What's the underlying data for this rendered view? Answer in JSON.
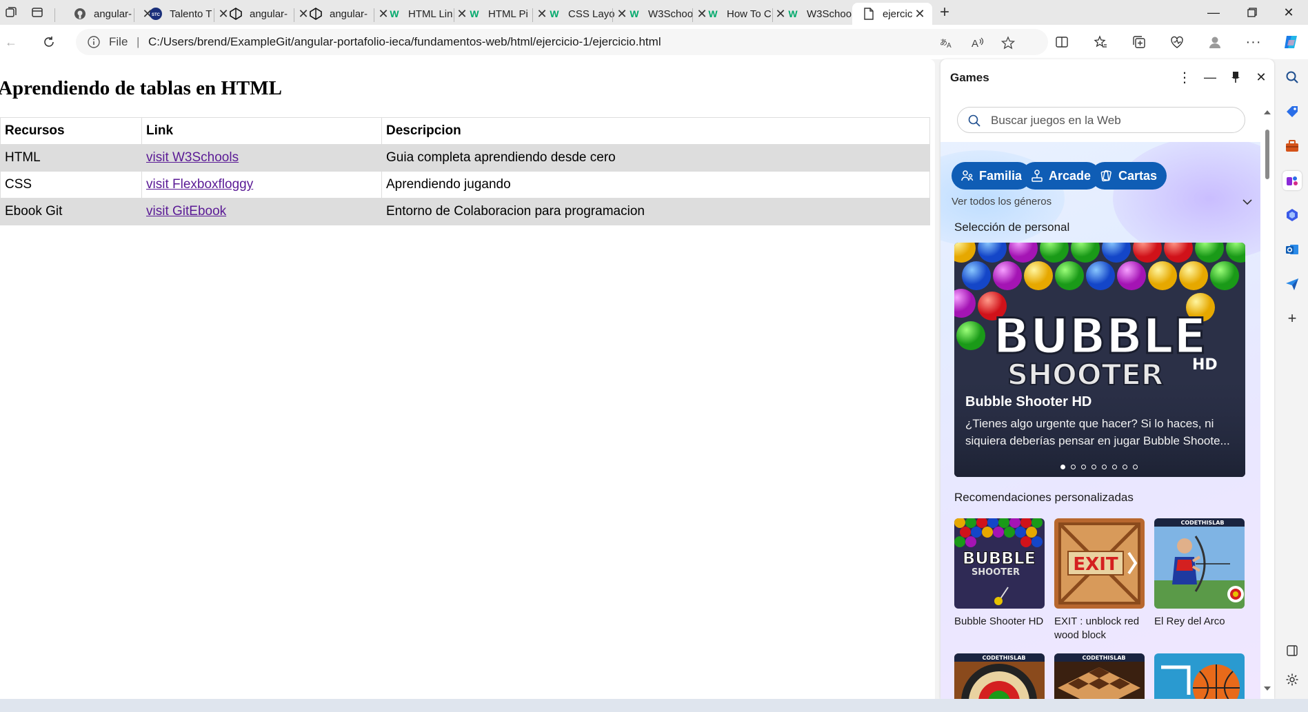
{
  "tabs": [
    {
      "title": "angular-",
      "icon": "github-icon"
    },
    {
      "title": "Talento T",
      "icon": "stc-icon"
    },
    {
      "title": "angular-",
      "icon": "codepen-icon"
    },
    {
      "title": "angular-",
      "icon": "codepen-icon"
    },
    {
      "title": "HTML Lin",
      "icon": "w3schools-icon"
    },
    {
      "title": "HTML Pi",
      "icon": "w3schools-icon"
    },
    {
      "title": "CSS Layo",
      "icon": "w3schools-icon"
    },
    {
      "title": "W3Schoo",
      "icon": "w3schools-icon"
    },
    {
      "title": "How To C",
      "icon": "w3schools-icon"
    },
    {
      "title": "W3Schoo",
      "icon": "w3schools-icon"
    },
    {
      "title": "ejercicio.",
      "icon": "file-icon",
      "active": true
    }
  ],
  "address": {
    "scheme_label": "File",
    "separator": "|",
    "url": "C:/Users/brend/ExampleGit/angular-portafolio-ieca/fundamentos-web/html/ejercicio-1/ejercicio.html"
  },
  "page": {
    "heading": "Aprendiendo de tablas en HTML",
    "table": {
      "headers": [
        "Recursos",
        "Link",
        "Descripcion"
      ],
      "rows": [
        {
          "recurso": "HTML",
          "link": "visit W3Schools",
          "descripcion": "Guia completa aprendiendo desde cero"
        },
        {
          "recurso": "CSS",
          "link": "visit Flexboxfloggy",
          "descripcion": "Aprendiendo jugando"
        },
        {
          "recurso": "Ebook Git",
          "link": "visit GitEbook",
          "descripcion": "Entorno de Colaboracion para programacion"
        }
      ]
    }
  },
  "games_panel": {
    "title": "Games",
    "search_placeholder": "Buscar juegos en la Web",
    "genres": [
      "Familia",
      "Arcade",
      "Cartas"
    ],
    "all_genres": "Ver todos los géneros",
    "staff_pick": {
      "section_title": "Selección de personal",
      "art_title_line1": "BUBBLE",
      "art_title_line2": "SHOOTER",
      "art_title_suffix": "HD",
      "name": "Bubble Shooter HD",
      "description": "¿Tienes algo urgente que hacer? Si lo haces, ni siquiera deberías pensar en jugar Bubble Shoote...",
      "slide_count": 8,
      "active_slide": 0
    },
    "recommendations": {
      "section_title": "Recomendaciones personalizadas",
      "cards": [
        {
          "name": "Bubble Shooter HD",
          "art_line1": "BUBBLE",
          "art_line2": "SHOOTER"
        },
        {
          "name": "EXIT : unblock red wood block",
          "art_text": "EXIT"
        },
        {
          "name": "El Rey del Arco",
          "badge": "CODETHISLAB"
        }
      ],
      "more_badges": [
        "CODETHISLAB",
        "CODETHISLAB"
      ]
    }
  },
  "colors": {
    "accent": "#0f5db5",
    "link_visited": "#5a1a95",
    "row_alt": "#dddddd"
  }
}
